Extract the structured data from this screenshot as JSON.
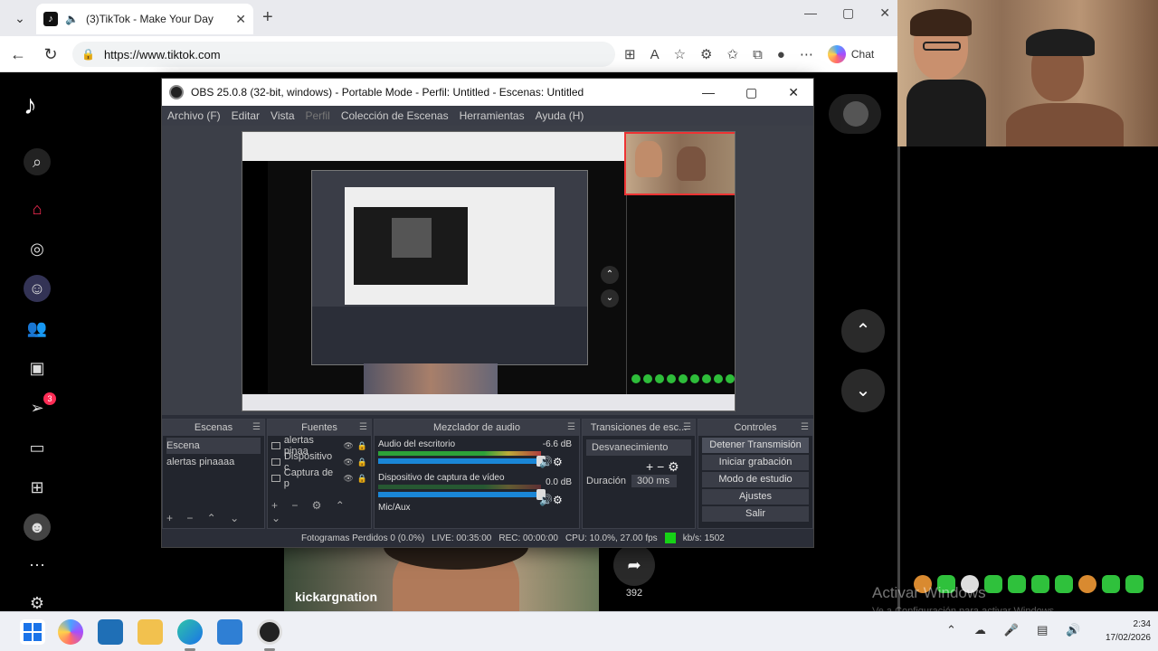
{
  "browser": {
    "tab_title": "(3)TikTok - Make Your Day",
    "url": "https://www.tiktok.com",
    "chat_label": "Chat"
  },
  "tiktok": {
    "notification_count": "3",
    "video_author": "kickargnation",
    "share_count": "392"
  },
  "obs": {
    "title": "OBS 25.0.8 (32-bit, windows) - Portable Mode - Perfil: Untitled - Escenas: Untitled",
    "menu": [
      "Archivo (F)",
      "Editar",
      "Vista",
      "Perfil",
      "Colección de Escenas",
      "Herramientas",
      "Ayuda (H)"
    ],
    "docks": {
      "scenes": {
        "title": "Escenas",
        "items": [
          "Escena",
          "alertas pinaaaa"
        ]
      },
      "sources": {
        "title": "Fuentes",
        "items": [
          "alertas pinaa",
          "Dispositivo c",
          "Captura de p"
        ]
      },
      "mixer": {
        "title": "Mezclador de audio",
        "ch1_name": "Audio del escritorio",
        "ch1_db": "-6.6 dB",
        "ch2_name": "Dispositivo de captura de vídeo",
        "ch2_db": "0.0 dB",
        "ch3_name": "Mic/Aux"
      },
      "transitions": {
        "title": "Transiciones de esc...",
        "selected": "Desvanecimiento",
        "duration_label": "Duración",
        "duration_value": "300 ms"
      },
      "controls": {
        "title": "Controles",
        "buttons": [
          "Detener Transmisión",
          "Iniciar grabación",
          "Modo de estudio",
          "Ajustes",
          "Salir"
        ]
      }
    },
    "status": {
      "dropped": "Fotogramas Perdidos 0 (0.0%)",
      "live": "LIVE: 00:35:00",
      "rec": "REC: 00:00:00",
      "cpu": "CPU: 10.0%, 27.00 fps",
      "kbps": "kb/s: 1502"
    }
  },
  "overlay": {
    "activate_title": "Activar Windows",
    "activate_sub": "Ve a Configuración para activar Windows."
  },
  "taskbar": {
    "time": "2:34",
    "date": "17/02/2026"
  },
  "colors": {
    "tiktok_red": "#fe2c55",
    "obs_bg": "#2b2e38",
    "live_indicator": "#16d216",
    "camera_border": "#ee3333"
  }
}
